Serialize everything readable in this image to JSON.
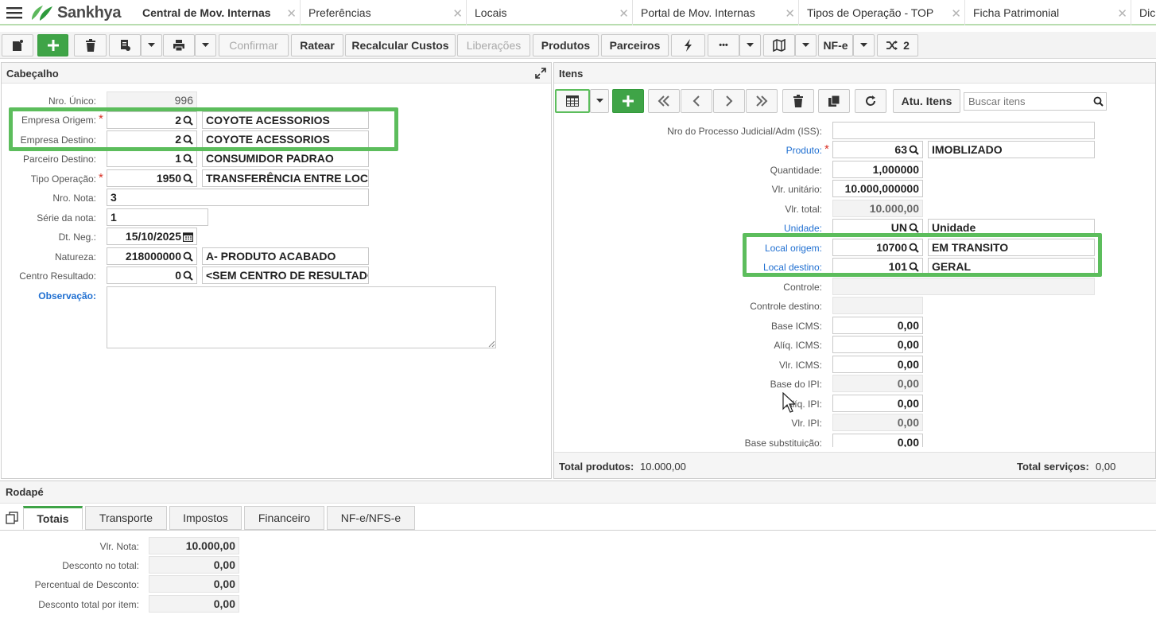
{
  "brand": {
    "name": "Sankhya",
    "accent": "#3fa447"
  },
  "tabs": [
    {
      "label": "Central de Mov. Internas",
      "active": true
    },
    {
      "label": "Preferências"
    },
    {
      "label": "Locais"
    },
    {
      "label": "Portal de Mov. Internas"
    },
    {
      "label": "Tipos de Operação - TOP"
    },
    {
      "label": "Ficha Patrimonial"
    },
    {
      "label": "Dici"
    }
  ],
  "toolbar": {
    "confirmar": "Confirmar",
    "ratear": "Ratear",
    "recalcular": "Recalcular Custos",
    "liberacoes": "Liberações",
    "produtos": "Produtos",
    "parceiros": "Parceiros",
    "more": "•••",
    "nfe": "NF-e",
    "count": "2"
  },
  "cabecalho": {
    "title": "Cabeçalho",
    "nro_unico": {
      "label": "Nro. Único:",
      "value": "996"
    },
    "empresa_origem": {
      "label": "Empresa Origem:",
      "code": "2",
      "name": "COYOTE ACESSORIOS"
    },
    "empresa_destino": {
      "label": "Empresa Destino:",
      "code": "2",
      "name": "COYOTE ACESSORIOS"
    },
    "parceiro_destino": {
      "label": "Parceiro Destino:",
      "code": "1",
      "name": "CONSUMIDOR PADRAO"
    },
    "tipo_operacao": {
      "label": "Tipo Operação:",
      "code": "1950",
      "name": "TRANSFERÊNCIA ENTRE LOCAI"
    },
    "nro_nota": {
      "label": "Nro. Nota:",
      "value": "3"
    },
    "serie_nota": {
      "label": "Série da nota:",
      "value": "1"
    },
    "dt_neg": {
      "label": "Dt. Neg.:",
      "value": "15/10/2025"
    },
    "natureza": {
      "label": "Natureza:",
      "code": "218000000",
      "name": "A- PRODUTO ACABADO"
    },
    "centro_resultado": {
      "label": "Centro Resultado:",
      "code": "0",
      "name": "<SEM CENTRO DE RESULTADO>"
    },
    "observacao": {
      "label": "Observação:",
      "value": ""
    }
  },
  "itens": {
    "title": "Itens",
    "atu_itens": "Atu. Itens",
    "search_placeholder": "Buscar itens",
    "processo_judicial": {
      "label": "Nro do Processo Judicial/Adm (ISS):",
      "value": ""
    },
    "produto": {
      "label": "Produto:",
      "code": "63",
      "name": "IMOBLIZADO"
    },
    "quantidade": {
      "label": "Quantidade:",
      "value": "1,000000"
    },
    "vlr_unitario": {
      "label": "Vlr. unitário:",
      "value": "10.000,000000"
    },
    "vlr_total": {
      "label": "Vlr. total:",
      "value": "10.000,00"
    },
    "unidade": {
      "label": "Unidade:",
      "code": "UN",
      "name": "Unidade"
    },
    "local_origem": {
      "label": "Local origem:",
      "code": "10700",
      "name": "EM TRANSITO"
    },
    "local_destino": {
      "label": "Local destino:",
      "code": "101",
      "name": "GERAL"
    },
    "controle": {
      "label": "Controle:",
      "value": ""
    },
    "controle_destino": {
      "label": "Controle destino:",
      "value": ""
    },
    "base_icms": {
      "label": "Base ICMS:",
      "value": "0,00"
    },
    "aliq_icms": {
      "label": "Alíq. ICMS:",
      "value": "0,00"
    },
    "vlr_icms": {
      "label": "Vlr. ICMS:",
      "value": "0,00"
    },
    "base_ipi": {
      "label": "Base do IPI:",
      "value": "0,00"
    },
    "aliq_ipi": {
      "label": "Alíq. IPI:",
      "value": "0,00"
    },
    "vlr_ipi": {
      "label": "Vlr. IPI:",
      "value": "0,00"
    },
    "base_subst": {
      "label": "Base substituição:",
      "value": "0,00"
    },
    "total_produtos": {
      "label": "Total produtos:",
      "value": "10.000,00"
    },
    "total_servicos": {
      "label": "Total serviços:",
      "value": "0,00"
    }
  },
  "rodape": {
    "title": "Rodapé",
    "tabs": [
      "Totais",
      "Transporte",
      "Impostos",
      "Financeiro",
      "NF-e/NFS-e"
    ],
    "vlr_nota": {
      "label": "Vlr. Nota:",
      "value": "10.000,00"
    },
    "desconto_total": {
      "label": "Desconto no total:",
      "value": "0,00"
    },
    "perc_desconto": {
      "label": "Percentual de Desconto:",
      "value": "0,00"
    },
    "desc_por_item": {
      "label": "Desconto total por item:",
      "value": "0,00"
    }
  }
}
